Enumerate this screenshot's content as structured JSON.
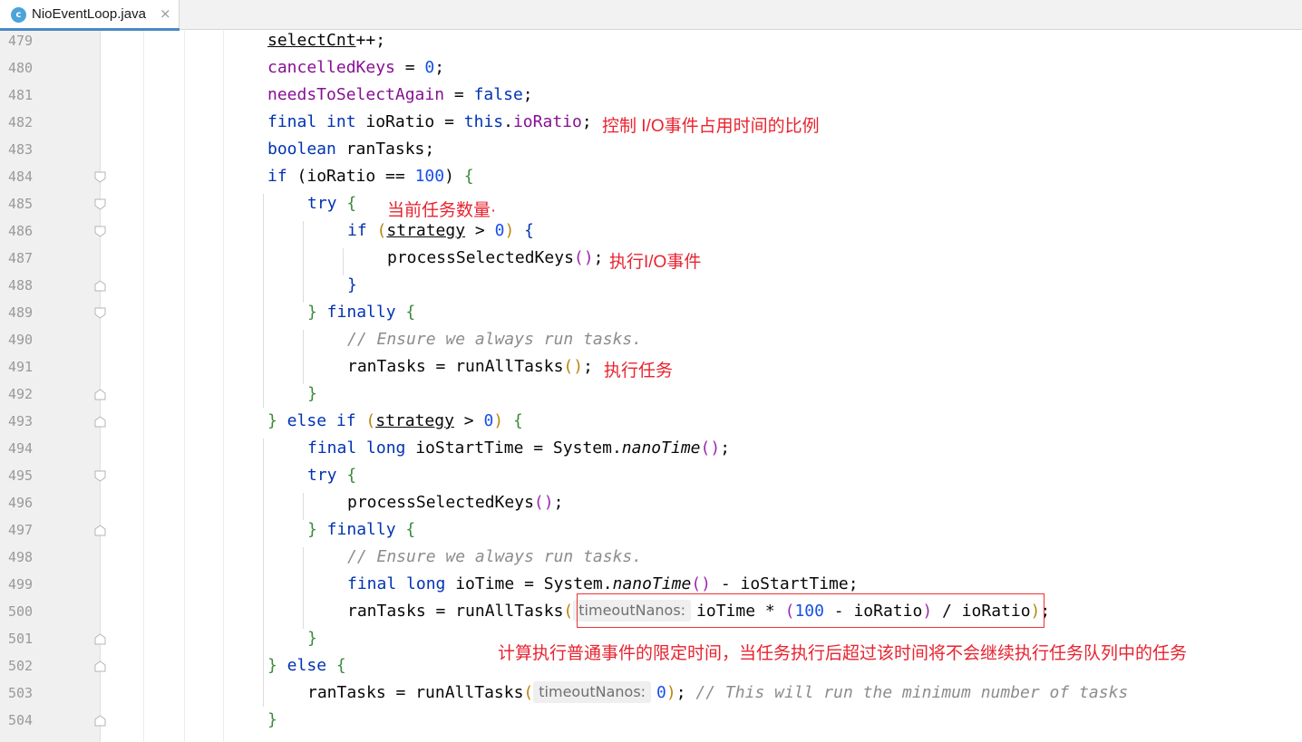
{
  "tab": {
    "title": "NioEventLoop.java",
    "icon_letter": "c",
    "close": "×"
  },
  "lines": [
    "479",
    "480",
    "481",
    "482",
    "483",
    "484",
    "485",
    "486",
    "487",
    "488",
    "489",
    "490",
    "491",
    "492",
    "493",
    "494",
    "495",
    "496",
    "497",
    "498",
    "499",
    "500",
    "501",
    "502",
    "503",
    "504"
  ],
  "code": {
    "l479": {
      "v": "selectCnt",
      "t": "++;"
    },
    "l480": {
      "v": "cancelledKeys",
      "t": " = ",
      "n": "0",
      "e": ";"
    },
    "l481": {
      "v": "needsToSelectAgain",
      "t": " = ",
      "k": "false",
      "e": ";"
    },
    "l482": {
      "k1": "final",
      "k2": "int",
      "t1": " ioRatio = ",
      "k3": "this",
      "t2": ".",
      "f": "ioRatio",
      "e": ";"
    },
    "l483": {
      "k": "boolean",
      "t": " ranTasks;"
    },
    "l484": {
      "k": "if",
      "t1": " (ioRatio == ",
      "n": "100",
      "t2": ") ",
      "b": "{"
    },
    "l485": {
      "k": "try",
      "b": " {"
    },
    "l486": {
      "k": "if",
      "p": "(",
      "v": "strategy",
      "t": " > ",
      "n": "0",
      "pc": ")",
      "b": " {"
    },
    "l487": {
      "t": "processSelectedKeys",
      "p": "()",
      "e": ";"
    },
    "l488": {
      "b": "}"
    },
    "l489": {
      "b1": "}",
      "k": " finally",
      "b2": " {"
    },
    "l490": {
      "c": "// Ensure we always run tasks."
    },
    "l491": {
      "t": "ranTasks = runAllTasks",
      "p": "()",
      "e": ";"
    },
    "l492": {
      "b": "}"
    },
    "l493": {
      "b1": "}",
      "k": " else if",
      "t1": " ",
      "p": "(",
      "v": "strategy",
      "t2": " > ",
      "n": "0",
      "pc": ")",
      "b2": " {"
    },
    "l494": {
      "k1": "final",
      "k2": " long",
      "t1": " ioStartTime = System.",
      "m": "nanoTime",
      "p": "()",
      "e": ";"
    },
    "l495": {
      "k": "try",
      "b": " {"
    },
    "l496": {
      "t": "processSelectedKeys",
      "p": "()",
      "e": ";"
    },
    "l497": {
      "b1": "}",
      "k": " finally",
      "b2": " {"
    },
    "l498": {
      "c": "// Ensure we always run tasks."
    },
    "l499": {
      "k1": "final",
      "k2": " long",
      "t1": " ioTime = System.",
      "m": "nanoTime",
      "p": "()",
      "t2": " - ioStartTime;"
    },
    "l500": {
      "t1": "ranTasks = runAllTasks",
      "p": "(",
      "hint": "timeoutNanos:",
      "t2": "ioTime * ",
      "p2": "(",
      "n": "100",
      "t3": " - ioRatio",
      "p2c": ")",
      "t4": " / ioRatio",
      "pc": ")",
      "e": ";"
    },
    "l501": {
      "b": "}"
    },
    "l502": {
      "b1": "}",
      "k": " else",
      "b2": " {"
    },
    "l503": {
      "t1": "ranTasks = runAllTasks",
      "p": "(",
      "hint": "timeoutNanos:",
      "n": "0",
      "pc": ")",
      "e": "; ",
      "c": "// This will run the minimum number of tasks"
    },
    "l504": {
      "b": "}"
    }
  },
  "annotations": {
    "a482": "控制 I/O事件占用时间的比例",
    "a485": "当前任务数量·",
    "a487": "执行I/O事件",
    "a491": "执行任务",
    "a501": "计算执行普通事件的限定时间，当任务执行后超过该时间将不会继续执行任务队列中的任务"
  },
  "colors": {
    "keyword": "#0033b3",
    "field": "#871094",
    "number": "#1750eb",
    "comment": "#8c8c8c",
    "annotation": "#e8232f"
  }
}
